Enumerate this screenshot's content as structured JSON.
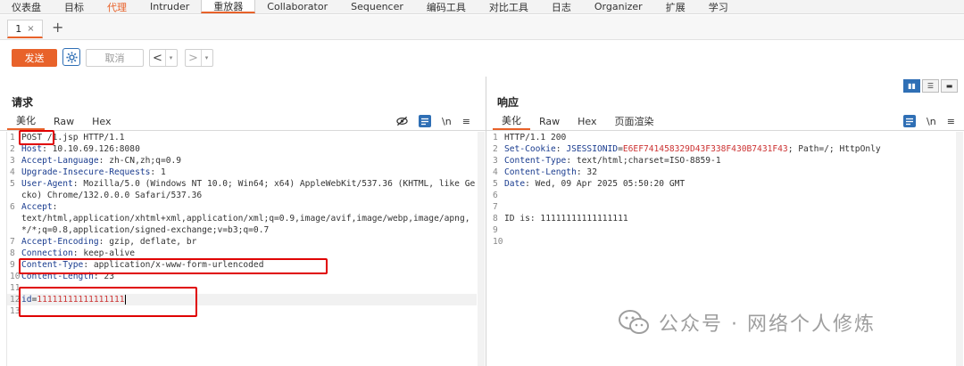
{
  "top_nav": {
    "tabs": [
      "仪表盘",
      "目标",
      "代理",
      "Intruder",
      "重放器",
      "Collaborator",
      "Sequencer",
      "编码工具",
      "对比工具",
      "日志",
      "Organizer",
      "扩展",
      "学习"
    ],
    "active_index": 4,
    "highlight_index": 2
  },
  "sub_tabs": {
    "tab_label": "1",
    "close": "×",
    "add": "+"
  },
  "toolbar": {
    "send": "发送",
    "cancel": "取消",
    "back": "<",
    "forward": ">",
    "dropdown": "▾"
  },
  "request": {
    "title": "请求",
    "tabs": [
      "美化",
      "Raw",
      "Hex"
    ],
    "active_tab": 0,
    "tools": {
      "newline": "\\n",
      "menu": "≡"
    },
    "lines": [
      {
        "n": "1",
        "parts": [
          [
            "hv",
            "POST"
          ],
          [
            "hv",
            " /1.jsp HTTP/1.1"
          ]
        ]
      },
      {
        "n": "2",
        "parts": [
          [
            "hk",
            "Host"
          ],
          [
            "hv",
            ": 10.10.69.126:8080"
          ]
        ]
      },
      {
        "n": "3",
        "parts": [
          [
            "hk",
            "Accept-Language"
          ],
          [
            "hv",
            ": zh-CN,zh;q=0.9"
          ]
        ]
      },
      {
        "n": "4",
        "parts": [
          [
            "hk",
            "Upgrade-Insecure-Requests"
          ],
          [
            "hv",
            ": 1"
          ]
        ]
      },
      {
        "n": "5",
        "parts": [
          [
            "hk",
            "User-Agent"
          ],
          [
            "hv",
            ": Mozilla/5.0 (Windows NT 10.0; Win64; x64) AppleWebKit/537.36 (KHTML, like Gecko) Chrome/132.0.0.0 Safari/537.36"
          ]
        ]
      },
      {
        "n": "6",
        "parts": [
          [
            "hk",
            "Accept"
          ],
          [
            "hv",
            ":\ntext/html,application/xhtml+xml,application/xml;q=0.9,image/avif,image/webp,image/apng,*/*;q=0.8,application/signed-exchange;v=b3;q=0.7"
          ]
        ]
      },
      {
        "n": "7",
        "parts": [
          [
            "hk",
            "Accept-Encoding"
          ],
          [
            "hv",
            ": gzip, deflate, br"
          ]
        ]
      },
      {
        "n": "8",
        "parts": [
          [
            "hk",
            "Connection"
          ],
          [
            "hv",
            ": keep-alive"
          ]
        ]
      },
      {
        "n": "9",
        "parts": [
          [
            "hk",
            "Content-Type"
          ],
          [
            "hv",
            ": application/x-www-form-urlencoded"
          ]
        ]
      },
      {
        "n": "10",
        "parts": [
          [
            "hk",
            "Content-Length"
          ],
          [
            "hv",
            ": 23"
          ]
        ]
      },
      {
        "n": "11",
        "parts": []
      },
      {
        "n": "12",
        "parts": [
          [
            "pk",
            "id"
          ],
          [
            "hv",
            "="
          ],
          [
            "pv",
            "11111111111111111"
          ]
        ],
        "cursor": true
      },
      {
        "n": "13",
        "parts": []
      }
    ]
  },
  "response": {
    "title": "响应",
    "tabs": [
      "美化",
      "Raw",
      "Hex",
      "页面渲染"
    ],
    "active_tab": 0,
    "tools": {
      "newline": "\\n",
      "menu": "≡"
    },
    "lines": [
      {
        "n": "1",
        "parts": [
          [
            "hv",
            "HTTP/1.1 200"
          ]
        ]
      },
      {
        "n": "2",
        "parts": [
          [
            "hk",
            "Set-Cookie"
          ],
          [
            "hv",
            ": "
          ],
          [
            "pk",
            "JSESSIONID"
          ],
          [
            "hv",
            "="
          ],
          [
            "pv",
            "E6EF741458329D43F338F430B7431F43"
          ],
          [
            "hv",
            "; Path=/; HttpOnly"
          ]
        ]
      },
      {
        "n": "3",
        "parts": [
          [
            "hk",
            "Content-Type"
          ],
          [
            "hv",
            ": text/html;charset=ISO-8859-1"
          ]
        ]
      },
      {
        "n": "4",
        "parts": [
          [
            "hk",
            "Content-Length"
          ],
          [
            "hv",
            ": 32"
          ]
        ]
      },
      {
        "n": "5",
        "parts": [
          [
            "hk",
            "Date"
          ],
          [
            "hv",
            ": Wed, 09 Apr 2025 05:50:20 GMT"
          ]
        ]
      },
      {
        "n": "6",
        "parts": []
      },
      {
        "n": "7",
        "parts": []
      },
      {
        "n": "8",
        "parts": [
          [
            "hv",
            "ID is: 11111111111111111"
          ]
        ]
      },
      {
        "n": "9",
        "parts": []
      },
      {
        "n": "10",
        "parts": []
      }
    ]
  },
  "watermark": {
    "text": "公众号 · 网络个人修炼"
  },
  "colors": {
    "accent": "#e8622a",
    "blue": "#2f6fb5",
    "highlight_red": "#e00000"
  }
}
